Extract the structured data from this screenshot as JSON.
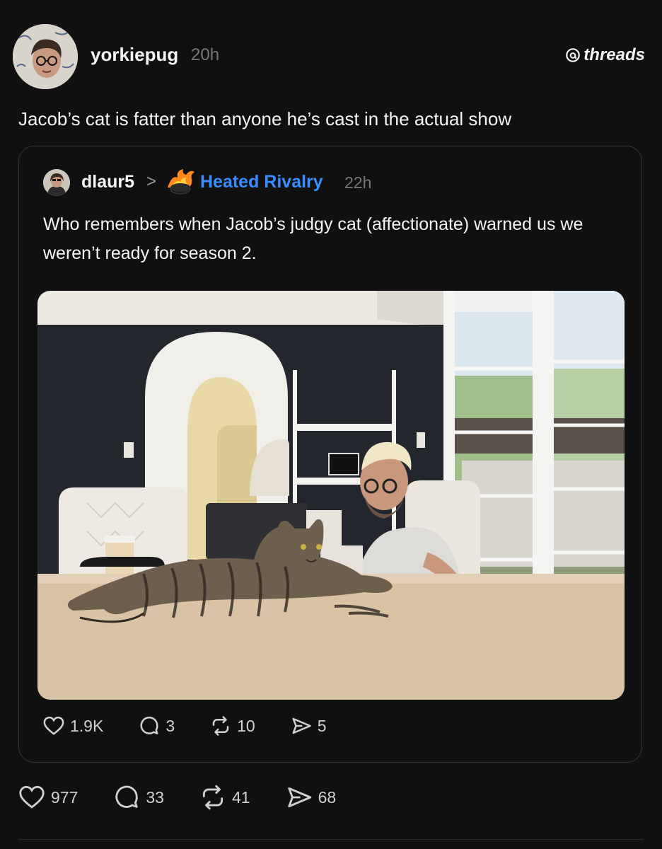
{
  "post": {
    "username": "yorkiepug",
    "time": "20h",
    "text": "Jacob’s cat is fatter than anyone he’s cast in the actual show",
    "stats": {
      "likes": "977",
      "replies": "33",
      "reposts": "41",
      "shares": "68"
    }
  },
  "brand": {
    "label": "threads"
  },
  "quote": {
    "username": "dlaur5",
    "chevron": ">",
    "community": "Heated Rivalry",
    "time": "22h",
    "text": "Who remembers when Jacob’s judgy cat (affectionate) warned us we weren’t ready for season 2.",
    "stats": {
      "likes": "1.9K",
      "replies": "3",
      "reposts": "10",
      "shares": "5"
    }
  },
  "colors": {
    "background": "#101010",
    "text": "#f3f5f7",
    "muted": "#777777",
    "community_link": "#3a8dff"
  },
  "icons": [
    "threads-logo-icon",
    "heart-icon",
    "comment-icon",
    "repost-icon",
    "share-icon",
    "flaming-puck-icon"
  ]
}
